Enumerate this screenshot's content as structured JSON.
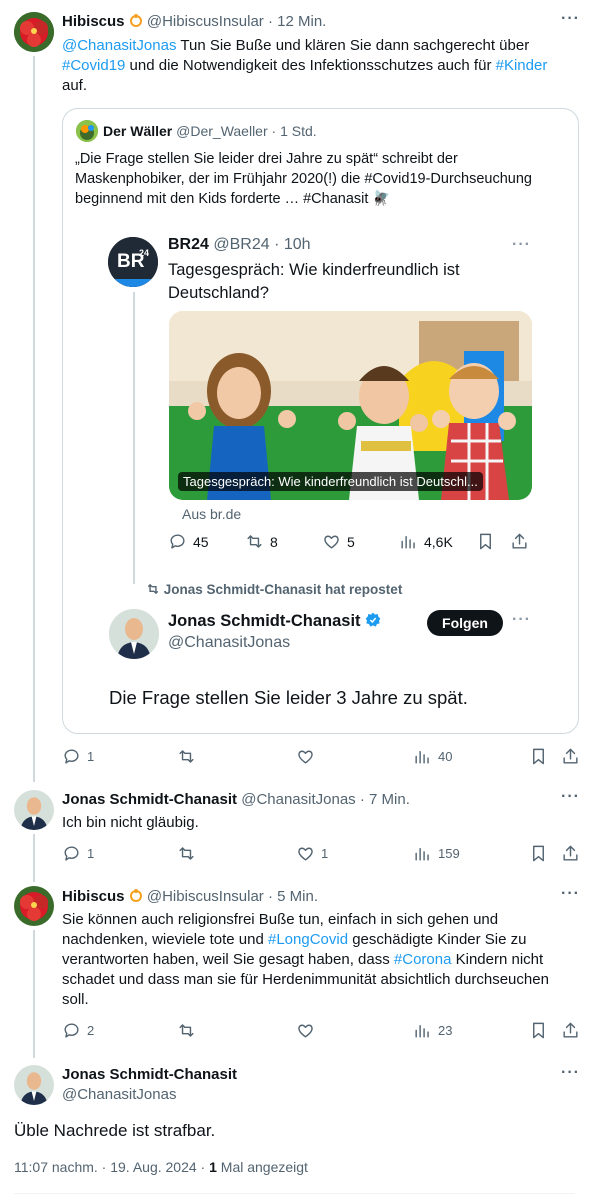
{
  "tweet1": {
    "name": "Hibiscus",
    "handle": "@HibiscusInsular",
    "time": "· 12 Min.",
    "mention": "@ChanasitJonas",
    "text_a": " Tun Sie Buße und klären Sie dann sachgerecht über ",
    "tag1": "#Covid19",
    "text_b": " und die Notwendigkeit des Infektionsschutzes auch für ",
    "tag2": "#Kinder",
    "text_c": "auf.",
    "replies": "1",
    "retweets": "",
    "likes": "",
    "views": "40"
  },
  "quote": {
    "name": "Der Wäller",
    "handle": "@Der_Waeller",
    "time": "· 1 Std.",
    "text_l1": "„Die Frage stellen Sie leider drei Jahre zu spät“ schreibt der",
    "text_l2": "Maskenphobiker, der im Frühjahr 2020(!) die #Covid19-Durchseuchung",
    "text_l3": "beginnend mit den Kids forderte … #Chanasit 🪰"
  },
  "br24": {
    "logo_text": "BR",
    "logo_sup": "24",
    "name": "BR24",
    "handle": "@BR24",
    "time": "· 10h",
    "text_l1": "Tagesgespräch: Wie kinderfreundlich ist",
    "text_l2": "Deutschland?",
    "image_caption": "Tagesgespräch: Wie kinderfreundlich ist Deutschl...",
    "source": "Aus br.de",
    "replies": "45",
    "retweets": "8",
    "likes": "5",
    "views": "4,6K"
  },
  "repost_banner": "Jonas Schmidt-Chanasit hat repostet",
  "jonas_card": {
    "name": "Jonas Schmidt-Chanasit",
    "handle": "@ChanasitJonas",
    "follow_label": "Folgen",
    "text": "Die Frage stellen Sie leider 3 Jahre zu spät."
  },
  "tweet2": {
    "name": "Jonas Schmidt-Chanasit",
    "handle": "@ChanasitJonas",
    "time": "· 7 Min.",
    "text": "Ich bin nicht gläubig.",
    "replies": "1",
    "retweets": "",
    "likes": "1",
    "views": "159"
  },
  "tweet3": {
    "name": "Hibiscus",
    "handle": "@HibiscusInsular",
    "time": "· 5 Min.",
    "l1": "Sie können auch religionsfrei Buße tun, einfach in sich gehen und",
    "l2a": "nachdenken, wieviele tote und ",
    "l2tag": "#LongCovid",
    "l2b": " geschädigte Kinder Sie zu",
    "l3": "verantworten haben, weil Sie gesagt haben, dass ",
    "l3tag": "#Corona",
    "l3b": " Kindern nicht",
    "l4": "schadet und dass man sie für Herdenimmunität absichtlich durchseuchen",
    "l5": "soll.",
    "replies": "2",
    "retweets": "",
    "likes": "",
    "views": "23"
  },
  "main": {
    "name": "Jonas Schmidt-Chanasit",
    "handle": "@ChanasitJonas",
    "text": "Üble Nachrede ist strafbar.",
    "timestamp": "11:07 nachm. · 19. Aug. 2024 · ",
    "view_count": "1",
    "view_label": " Mal angezeigt"
  },
  "colors": {
    "link": "#1d9bf0",
    "verified": "#1d9bf0",
    "secondary_text": "#536471",
    "thread_line": "#cfd9de"
  },
  "icons": [
    "reply-icon",
    "retweet-icon",
    "like-icon",
    "views-icon",
    "bookmark-icon",
    "share-icon",
    "more-icon",
    "verified-badge-icon",
    "repost-icon",
    "hibiscus-badge-icon"
  ]
}
